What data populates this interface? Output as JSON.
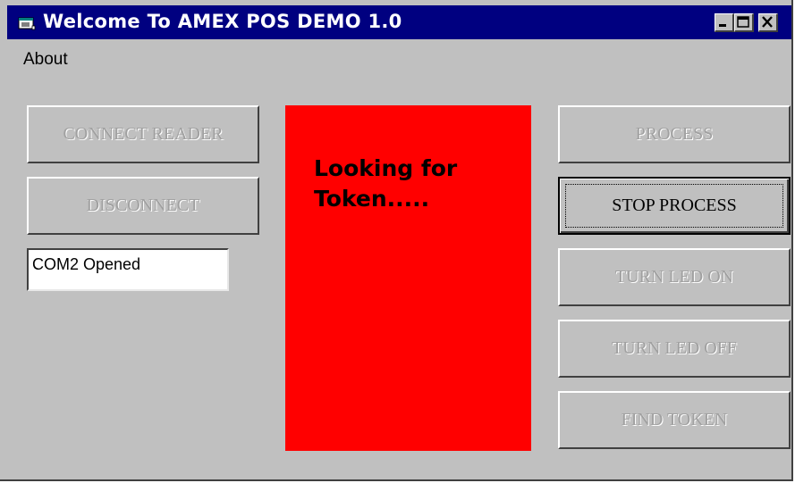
{
  "window": {
    "title": "Welcome To AMEX POS DEMO 1.0",
    "icons": {
      "app": "app-icon",
      "minimize": "minimize-icon",
      "maximize": "maximize-icon",
      "close": "close-icon"
    }
  },
  "menu": {
    "about": "About"
  },
  "left": {
    "connect_label": "CONNECT READER",
    "disconnect_label": "DISCONNECT",
    "status_value": "COM2 Opened"
  },
  "status": {
    "text": "Looking for\nToken.....",
    "color": "#ff0000"
  },
  "right": {
    "process_label": "PROCESS",
    "stop_label": "STOP PROCESS",
    "led_on_label": "TURN LED ON",
    "led_off_label": "TURN LED OFF",
    "find_label": "FIND TOKEN"
  },
  "colors": {
    "titlebar": "#000080",
    "face": "#c0c0c0"
  }
}
